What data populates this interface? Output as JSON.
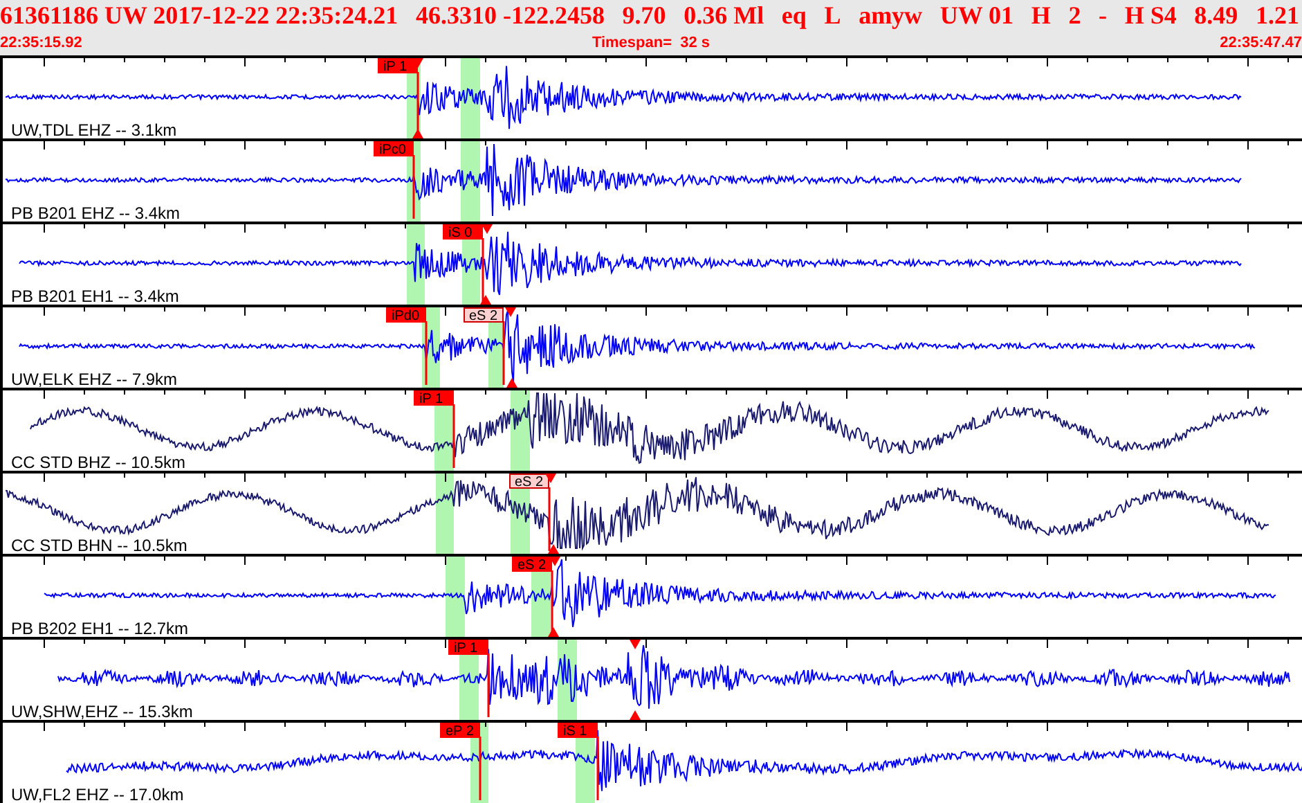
{
  "header": {
    "fields": [
      "61361186 UW 2017-12-22 22:35:24.21",
      "46.3310 -122.2458",
      "9.70",
      "0.36 Ml",
      "eq",
      "L",
      "amyw",
      "UW 01",
      "H",
      "2",
      "-",
      "H S4",
      "8.49",
      "1.21"
    ],
    "start_time": "22:35:15.92",
    "timespan": "Timespan=  32 s",
    "end_time": "22:35:47.47"
  },
  "traces": [
    {
      "label": "UW,TDL EHZ -- 3.1km",
      "kind": "quiet",
      "color": "#0000ff",
      "picks": [
        {
          "label": "iP 1",
          "kind": "solid"
        }
      ]
    },
    {
      "label": "PB B201 EHZ -- 3.4km",
      "kind": "quiet",
      "color": "#0000ff",
      "picks": [
        {
          "label": "iPc0",
          "kind": "solid"
        }
      ]
    },
    {
      "label": "PB B201 EH1 -- 3.4km",
      "kind": "quiet",
      "color": "#0000ff",
      "picks": [
        {
          "label": "iS 0",
          "kind": "solid"
        }
      ]
    },
    {
      "label": "UW,ELK EHZ -- 7.9km",
      "kind": "quiet",
      "color": "#0000ff",
      "picks": [
        {
          "label": "iPd0",
          "kind": "solid"
        },
        {
          "label": "eS 2",
          "kind": "outline"
        }
      ]
    },
    {
      "label": "CC STD BHZ -- 10.5km",
      "kind": "swaying",
      "color": "#1a1a6e",
      "picks": [
        {
          "label": "iP 1",
          "kind": "solid"
        }
      ]
    },
    {
      "label": "CC STD BHN -- 10.5km",
      "kind": "swaying",
      "color": "#1a1a6e",
      "picks": [
        {
          "label": "eS 2",
          "kind": "outline"
        }
      ]
    },
    {
      "label": "PB B202 EH1 -- 12.7km",
      "kind": "quiet",
      "color": "#0000ff",
      "picks": [
        {
          "label": "eS 2",
          "kind": "solid"
        }
      ]
    },
    {
      "label": "UW,SHW,EHZ -- 15.3km",
      "kind": "noisy",
      "color": "#0000ff",
      "picks": [
        {
          "label": "iP 1",
          "kind": "solid"
        }
      ]
    },
    {
      "label": "UW,FL2 EHZ -- 17.0km",
      "kind": "wandering",
      "color": "#0000ff",
      "picks": [
        {
          "label": "eP 2",
          "kind": "solid"
        },
        {
          "label": "iS 1",
          "kind": "solid"
        }
      ]
    }
  ]
}
